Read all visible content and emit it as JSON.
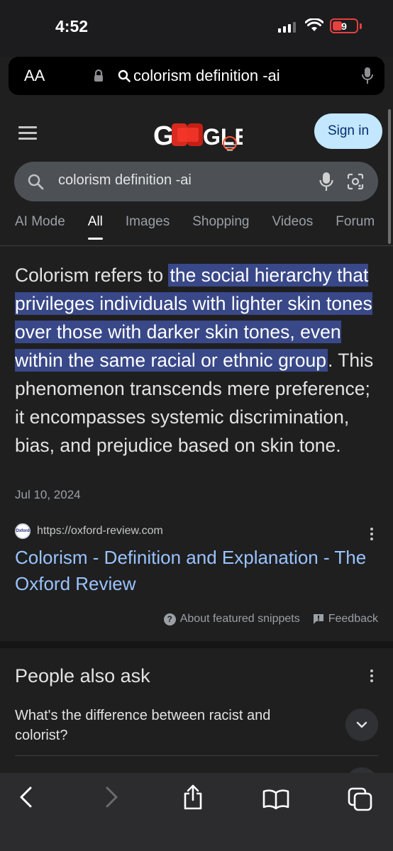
{
  "status_bar": {
    "time": "4:52",
    "battery": "9"
  },
  "browser": {
    "reader_label": "AA",
    "url_text": "colorism definition -ai"
  },
  "google": {
    "logo_text": "GOOGLE",
    "sign_in_label": "Sign in",
    "search_query": "colorism definition -ai",
    "tabs": [
      "AI Mode",
      "All",
      "Images",
      "Shopping",
      "Videos",
      "Forum"
    ],
    "active_tab": "All"
  },
  "featured_snippet": {
    "lead": "Colorism refers to ",
    "highlight": "the social hierarchy that privileges individuals with lighter skin tones over those with darker skin tones, even within the same racial or ethnic group",
    "rest": ". This phenomenon transcends mere preference; it encompasses systemic discrimination, bias, and prejudice based on skin tone.",
    "date": "Jul 10, 2024",
    "source_url": "https://oxford-review.com",
    "favicon_text": "Oxford",
    "result_title": "Colorism - Definition and Explanation - The Oxford Review",
    "about_label": "About featured snippets",
    "feedback_label": "Feedback"
  },
  "people_also_ask": {
    "title": "People also ask",
    "questions": [
      "What's the difference between racist and colorist?"
    ]
  },
  "colors": {
    "page_bg": "#1f1f1f",
    "link": "#99c3ff",
    "highlight_bg": "#394888",
    "signin_bg": "#c2e7ff",
    "search_bg": "#4d5156",
    "battery_red": "#e64040"
  }
}
